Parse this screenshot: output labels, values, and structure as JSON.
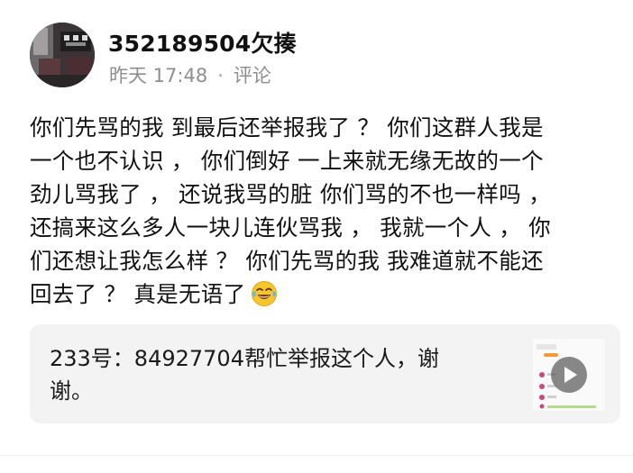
{
  "author": {
    "username": "352189504欠揍",
    "time": "昨天 17:48",
    "separator": "·",
    "comment_label": "评论"
  },
  "post": {
    "lines": [
      "你们先骂的我 到最后还举报我了 ？ 你们这群人我是",
      "一个也不认识 ， 你们倒好 一上来就无缘无故的一个",
      "劲儿骂我了 ， 还说我骂的脏 你们骂的不也一样吗 ，",
      "还搞来这么多人一块儿连伙骂我 ， 我就一个人 ，  你",
      "们还想让我怎么样 ？ 你们先骂的我 我难道就不能还",
      "回去了 ？ 真是无语了"
    ],
    "emoji": "laughing-crying-emoji"
  },
  "shared_card": {
    "lines": [
      "233号：84927704帮忙举报这个人，谢",
      "谢。"
    ],
    "thumbnail_icon": "play-icon"
  },
  "colors": {
    "text": "#111111",
    "meta": "#8e8e8e",
    "card_bg": "#f3f3f3",
    "emoji_face": "#f7c52d"
  }
}
